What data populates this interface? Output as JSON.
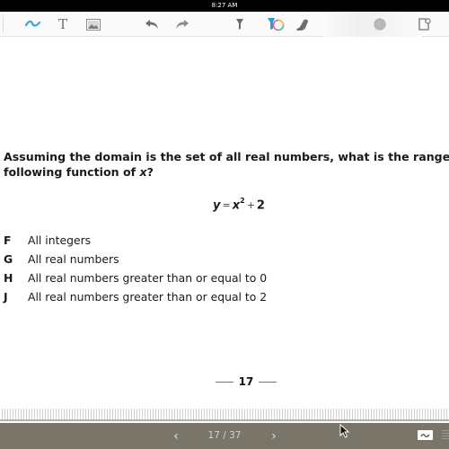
{
  "status_bar": {
    "time": "8:27 AM"
  },
  "toolbar": {
    "tools": [
      {
        "name": "pen-tool",
        "icon": "squiggle-icon",
        "color": "#3aa9d3"
      },
      {
        "name": "text-tool",
        "icon": "text-icon",
        "label": "T"
      },
      {
        "name": "image-tool",
        "icon": "image-icon"
      },
      {
        "name": "undo",
        "icon": "undo-icon"
      },
      {
        "name": "redo",
        "icon": "redo-icon"
      },
      {
        "name": "highlighter-tool",
        "icon": "highlighter-icon"
      },
      {
        "name": "color-picker",
        "icon": "color-wheel-icon"
      },
      {
        "name": "eraser-tool",
        "icon": "eraser-icon"
      },
      {
        "name": "settings",
        "icon": "gear-icon"
      },
      {
        "name": "export",
        "icon": "page-export-icon"
      }
    ]
  },
  "page": {
    "question_line1": "Assuming the domain is the set of all real numbers, what is the range",
    "question_line2_prefix": "following function of ",
    "question_line2_var": "x",
    "question_line2_suffix": "?",
    "equation": {
      "lhs": "y",
      "eq": "=",
      "base": "x",
      "exponent": "2",
      "plus": "+",
      "constant": "2"
    },
    "choices": [
      {
        "letter": "F",
        "text": "All integers"
      },
      {
        "letter": "G",
        "text": "All real numbers"
      },
      {
        "letter": "H",
        "text": "All real numbers greater than or equal to 0"
      },
      {
        "letter": "J",
        "text": "All real numbers greater than or equal to 2"
      }
    ],
    "page_number": "17"
  },
  "bottom_bar": {
    "prev_label": "‹",
    "next_label": "›",
    "current_page": 17,
    "total_pages": 37,
    "page_counter": "17 / 37"
  },
  "colors": {
    "accent_pen": "#3aa9d3",
    "bottom_bar_bg": "#797669",
    "status_bar_bg": "#000000"
  }
}
